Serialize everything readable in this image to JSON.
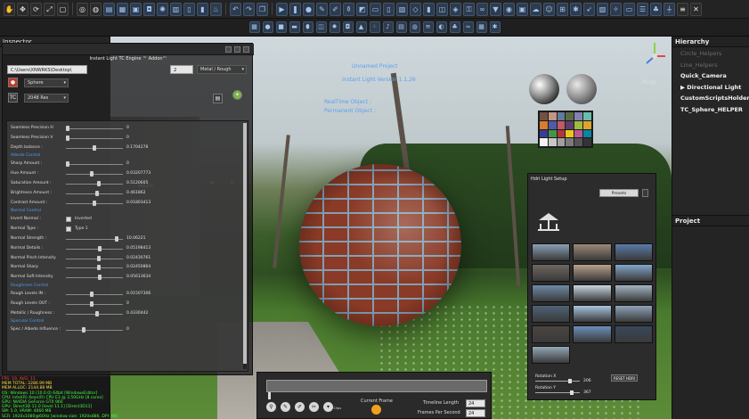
{
  "inspector": {
    "title": "Inspector"
  },
  "addon": {
    "title": "Instant Light TC Engine ™ Addon™",
    "path_value": "C:\\Users\\XNWRKS\\Desktop\\",
    "number_value": "2",
    "material_mode": "Metal / Rough",
    "shape_select": "Sphere",
    "tc_label": "TC",
    "res_select": "2048 Res",
    "metallic_small": "Metallic",
    "sliders": [
      {
        "label": "Seamless Precision H",
        "value": "0",
        "level": 0.0
      },
      {
        "label": "Seamless Precision V",
        "value": "0",
        "level": 0.0
      },
      {
        "label": "Depth balance :",
        "value": "0.1704278",
        "level": 0.5
      },
      {
        "label": "Sharp Amount :",
        "value": "0",
        "level": 0.0
      },
      {
        "label": "Hue Amount :",
        "value": "0.03207773",
        "level": 0.45
      },
      {
        "label": "Saturation Amount :",
        "value": "0.5120605",
        "level": 0.58
      },
      {
        "label": "Brightness Amount :",
        "value": "0.461862",
        "level": 0.55
      },
      {
        "label": "Contrast Amount :",
        "value": "0.01803413",
        "level": 0.5
      },
      {
        "label": "Normal Strength :",
        "value": "10.06221",
        "level": 0.92
      },
      {
        "label": "Normal Details :",
        "value": "0.05198413",
        "level": 0.6
      },
      {
        "label": "Normal Pinch Intensity",
        "value": "0.02430761",
        "level": 0.58
      },
      {
        "label": "Normal Sharp",
        "value": "0.02450864",
        "level": 0.58
      },
      {
        "label": "Normal Soft Intensity",
        "value": "0.05613634",
        "level": 0.6
      },
      {
        "label": "Rough Levels IN :",
        "value": "0.01507306",
        "level": 0.45
      },
      {
        "label": "Rough Levels OUT :",
        "value": "0",
        "level": 0.45
      },
      {
        "label": "Metallic / Roughness :",
        "value": "0.4330442",
        "level": 0.55
      },
      {
        "label": "Spec / Albedo Influence :",
        "value": "0",
        "level": 0.3
      }
    ],
    "sections": {
      "albedo": "Albedo Control",
      "normal": "Normal Control",
      "roughness": "Roughness Control",
      "specular": "Specular Control"
    },
    "toggles": [
      {
        "label": "Invert Normal :",
        "option": "Inverted"
      },
      {
        "label": "Normal Type :",
        "option": "Type 1"
      }
    ]
  },
  "viewport": {
    "project_name": "Unnamed Project",
    "version_line": "Instant Light Version 1.1.26",
    "realtime_label": "RealTime Object :",
    "permanent_label": "Permanent Object :",
    "persp_label": "Persp",
    "checker_colors": [
      "#735244",
      "#c29682",
      "#627a9d",
      "#576c43",
      "#8580b1",
      "#67bdaa",
      "#d67e2c",
      "#505ba6",
      "#c15a63",
      "#5e3c6c",
      "#9dbc40",
      "#e0a32e",
      "#383d96",
      "#469449",
      "#af363c",
      "#e7c71f",
      "#bb5695",
      "#0885a1",
      "#f3f3f2",
      "#c8c8c8",
      "#a0a0a0",
      "#7a7a79",
      "#555555",
      "#343434"
    ]
  },
  "hierarchy": {
    "title": "Hierarchy",
    "items": [
      {
        "label": "Circle_Helpers",
        "style": "dim"
      },
      {
        "label": "Line_Helpers",
        "style": "dim"
      },
      {
        "label": "Quick_Camera",
        "style": "bold"
      },
      {
        "label": "▶ Directional Light",
        "style": "bold"
      },
      {
        "label": "CustomScriptsHolder",
        "style": "bold"
      },
      {
        "label": "TC_Sphere_HELPER",
        "style": "bold"
      }
    ]
  },
  "project": {
    "title": "Project"
  },
  "hdri": {
    "title": "Hdri Light Setup",
    "presets_label": "Presets",
    "thumbs": [
      "#8aa0b4",
      "#9b8a76",
      "#5a7aa8",
      "#6d6660",
      "#b7a28a",
      "#83a6c9",
      "#6e8aa8",
      "#c8d6e0",
      "#a3b4c2",
      "#4e6278",
      "#a7c4e0",
      "#8fa3b8",
      "#4b4540",
      "#6b8fb8",
      "#39485a",
      "#95a7b5"
    ],
    "rotation_x_label": "Rotation X",
    "rotation_x_value": "206",
    "rotation_x_level": 0.8,
    "rotation_y_label": "Rotation Y",
    "rotation_y_value": "367",
    "rotation_y_level": 0.85,
    "reset_label": "RESET HDRI"
  },
  "timeline": {
    "load_label": "Load Clips",
    "current_frame_label": "Current Frame",
    "length_label": "Timeline Length",
    "length_value": "24",
    "fps_label": "Frames Per Second",
    "fps_value": "24"
  },
  "stats": {
    "lines": [
      {
        "text": "FPS: 19, AVG: 11",
        "color": "#ff4040"
      },
      {
        "text": "MEM TOTAL: 2286.99 MB",
        "color": "#ffe040"
      },
      {
        "text": "MEM ALLOC: 2144.88 MB",
        "color": "#ffe040"
      },
      {
        "text": "OS: Windows 10 (10.0.0) 64bit [WindowsEditor]",
        "color": "#40ff40"
      },
      {
        "text": "CPU: Intel(R) Xeon(R) CPU E3 @ 3.50GHz [8 cores]",
        "color": "#40ff40"
      },
      {
        "text": "GPU: NVIDIA GeForce GTX 960",
        "color": "#40ff40"
      },
      {
        "text": "GPU: Direct3D 11.0 [level 11.1] [Direct3D11]",
        "color": "#40ff40"
      },
      {
        "text": "SM: 5.0, VRAM: 4060 MB",
        "color": "#40ff40"
      },
      {
        "text": "SCR: 1920x1080@60Hz [window size: 1920x886, DPI: 96]",
        "color": "#40ff40"
      }
    ]
  }
}
